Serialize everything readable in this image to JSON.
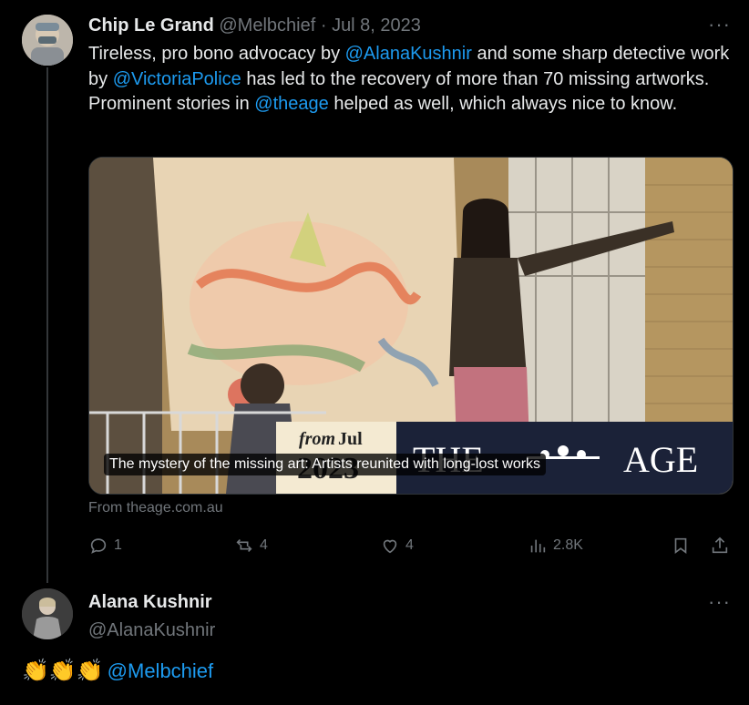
{
  "tweet1": {
    "author_name": "Chip Le Grand",
    "handle": "@Melbchief",
    "separator": "·",
    "date": "Jul 8, 2023",
    "more": "···",
    "text": {
      "t1": "Tireless, pro bono advocacy by ",
      "m1": "@AlanaKushnir",
      "t2": " and some sharp detective work by ",
      "m2": "@VictoriaPolice",
      "t3": " has led to the recovery of more than 70 missing artworks. Prominent stories in ",
      "m3": "@theage",
      "t4": " helped as well, which always nice to know."
    },
    "card": {
      "caption": "The mystery of the missing art: Artists reunited with long-lost works",
      "badge_from": "from",
      "badge_month": "Jul",
      "badge_year": "2023",
      "masthead_left": "THE",
      "masthead_right": "AGE"
    },
    "from_site": "From theage.com.au",
    "actions": {
      "replies": "1",
      "reposts": "4",
      "likes": "4",
      "views": "2.8K"
    }
  },
  "tweet2": {
    "author_name": "Alana Kushnir",
    "handle": "@AlanaKushnir",
    "more": "···",
    "claps": "👏👏👏",
    "mention": "@Melbchief"
  },
  "colors": {
    "background": "#000000",
    "text": "#e7e9ea",
    "muted": "#71767b",
    "accent": "#1d9bf0"
  }
}
